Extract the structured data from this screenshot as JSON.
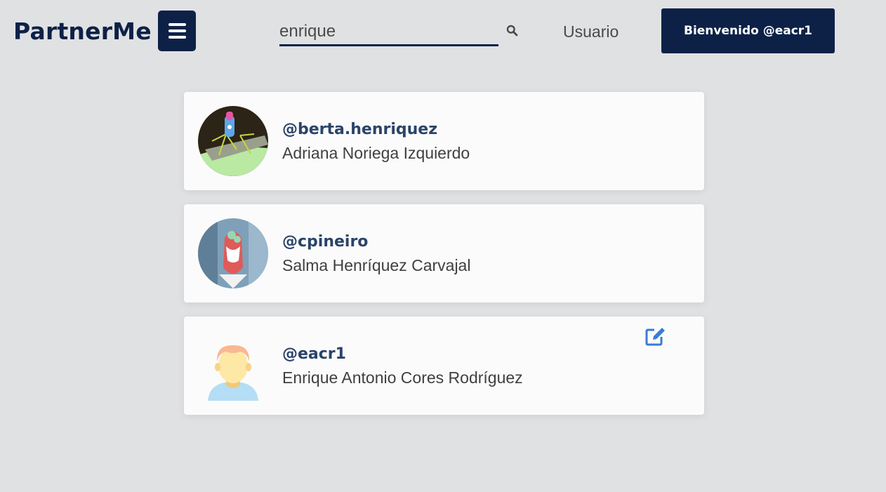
{
  "header": {
    "brand": "PartnerMe",
    "search_value": "enrique",
    "nav_user": "Usuario",
    "welcome": "Bienvenido @eacr1"
  },
  "icons": {
    "menu": "hamburger-menu-icon",
    "search": "search-icon",
    "edit": "edit-icon"
  },
  "colors": {
    "primary": "#0d2147",
    "background": "#e0e1e3",
    "card": "#fbfbfb",
    "handle": "#2a4468",
    "edit": "#3a7bd5"
  },
  "results": [
    {
      "handle": "@berta.henriquez",
      "name": "Adriana Noriega Izquierdo"
    },
    {
      "handle": "@cpineiro",
      "name": "Salma Henríquez Carvajal"
    },
    {
      "handle": "@eacr1",
      "name": "Enrique Antonio Cores Rodríguez"
    }
  ]
}
